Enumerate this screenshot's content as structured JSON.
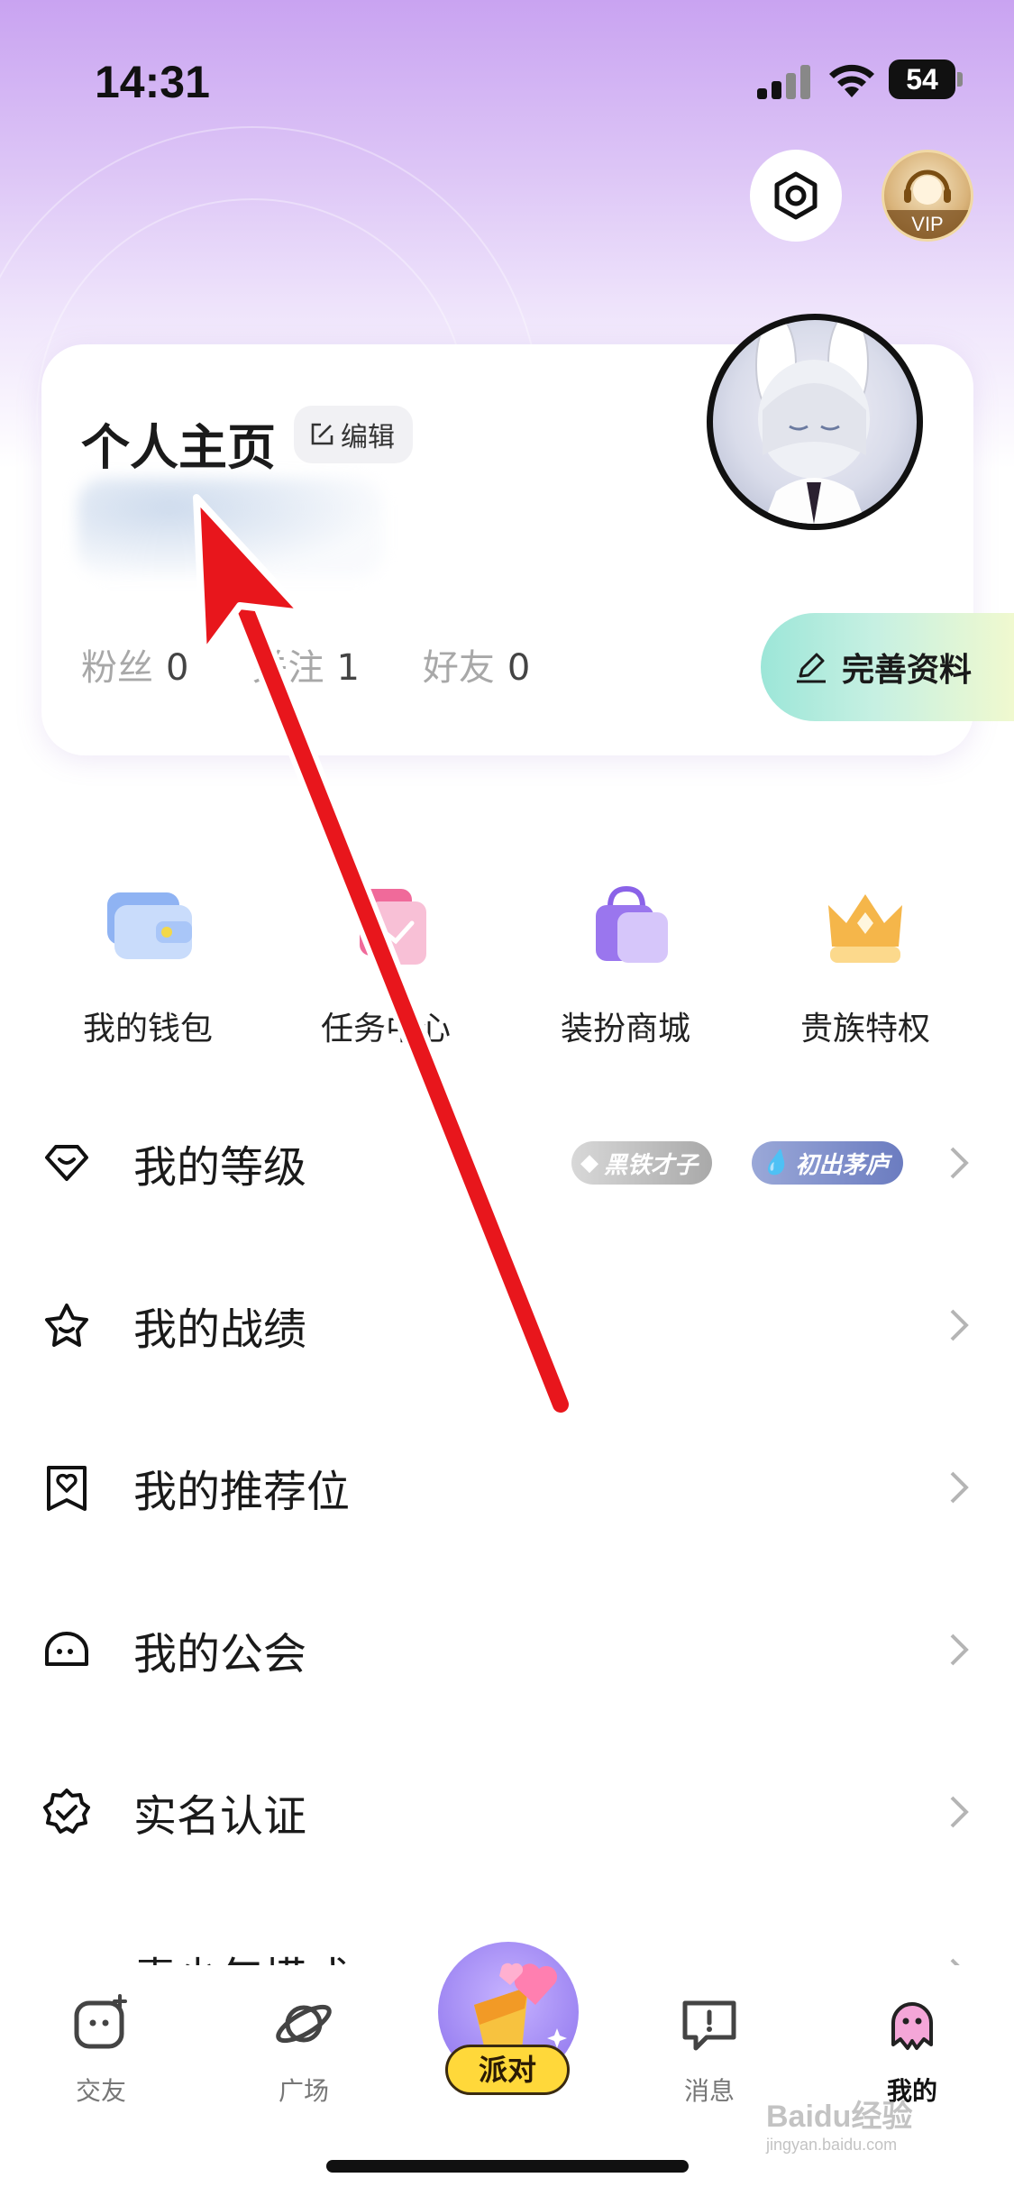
{
  "status_bar": {
    "time": "14:31",
    "battery": "54"
  },
  "header": {
    "vip_label": "VIP",
    "icons": [
      "settings-icon",
      "vip-avatar"
    ]
  },
  "profile": {
    "title": "个人主页",
    "edit_label": "编辑",
    "stats": [
      {
        "label": "粉丝",
        "value": "0"
      },
      {
        "label": "关注",
        "value": "1"
      },
      {
        "label": "好友",
        "value": "0"
      }
    ],
    "complete_label": "完善资料"
  },
  "quick_actions": [
    {
      "label": "我的钱包",
      "icon": "wallet-icon"
    },
    {
      "label": "任务中心",
      "icon": "task-icon"
    },
    {
      "label": "装扮商城",
      "icon": "shopping-bag-icon"
    },
    {
      "label": "贵族特权",
      "icon": "crown-icon"
    }
  ],
  "menu": [
    {
      "label": "我的等级",
      "icon": "diamond-heart-icon",
      "badges": [
        "黑铁才子",
        "初出茅庐"
      ]
    },
    {
      "label": "我的战绩",
      "icon": "star-crown-icon"
    },
    {
      "label": "我的推荐位",
      "icon": "bookmark-heart-icon"
    },
    {
      "label": "我的公会",
      "icon": "guild-icon"
    },
    {
      "label": "实名认证",
      "icon": "verified-badge-icon"
    },
    {
      "label": "青少年模式",
      "icon": "youth-mode-icon"
    }
  ],
  "bottom_nav": [
    {
      "label": "交友",
      "icon": "chat-face-icon"
    },
    {
      "label": "广场",
      "icon": "planet-icon"
    },
    {
      "label": "派对",
      "icon": "party-icon"
    },
    {
      "label": "消息",
      "icon": "message-icon"
    },
    {
      "label": "我的",
      "icon": "profile-ghost-icon",
      "active": true
    }
  ],
  "watermark": {
    "main": "Baidu经验",
    "sub": "jingyan.baidu.com"
  },
  "colors": {
    "accent_purple": "#c9a3f1",
    "arrow_red": "#e8161c",
    "party_yellow": "#ffd83a"
  }
}
